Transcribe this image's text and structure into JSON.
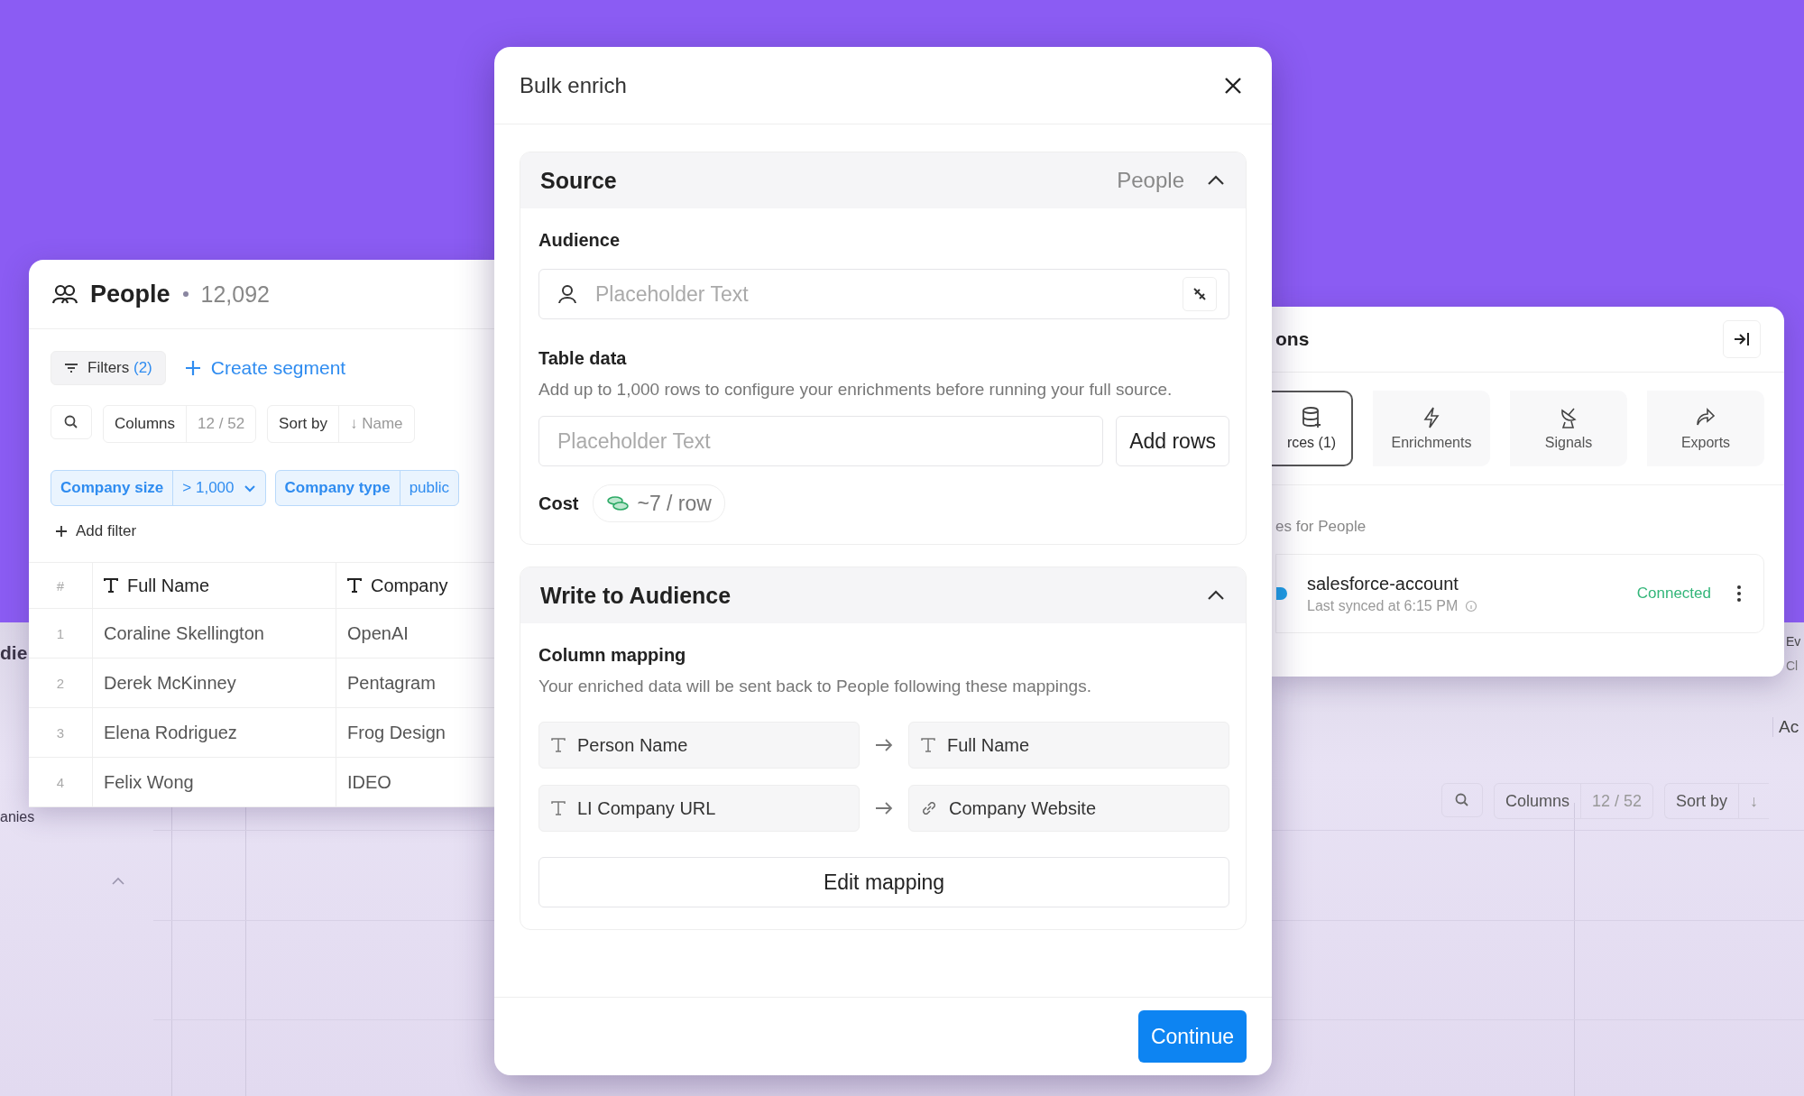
{
  "background_app": {
    "sidebar_texts": [
      "die",
      "anies"
    ],
    "right_texts": [
      "Ev",
      "Cl"
    ],
    "action_text": "Ac",
    "toolbar": {
      "columns_label": "Columns",
      "columns_count": "12 / 52",
      "sort_label": "Sort by",
      "sort_arrow": "↓"
    }
  },
  "people_panel": {
    "title": "People",
    "count": "12,092",
    "filters_label": "Filters",
    "filters_count": "(2)",
    "create_segment": "Create segment",
    "toolbar": {
      "columns_label": "Columns",
      "columns_count": "12 / 52",
      "sort_label": "Sort by",
      "sort_value": "↓ Name"
    },
    "filter_chips": [
      {
        "field": "Company size",
        "value": "> 1,000"
      },
      {
        "field": "Company type",
        "value": "public"
      }
    ],
    "add_filter": "Add filter",
    "table": {
      "columns": [
        "#",
        "Full Name",
        "Company"
      ],
      "rows": [
        {
          "index": "1",
          "name": "Coraline Skellington",
          "company": "OpenAI"
        },
        {
          "index": "2",
          "name": "Derek McKinney",
          "company": "Pentagram"
        },
        {
          "index": "3",
          "name": "Elena Rodriguez",
          "company": "Frog Design"
        },
        {
          "index": "4",
          "name": "Felix Wong",
          "company": "IDEO"
        }
      ]
    }
  },
  "integrations_panel": {
    "title": "ons",
    "tabs": [
      {
        "label": "rces (1)",
        "kind": "database",
        "selected": true
      },
      {
        "label": "Enrichments",
        "kind": "bolt",
        "selected": false
      },
      {
        "label": "Signals",
        "kind": "antenna",
        "selected": false
      },
      {
        "label": "Exports",
        "kind": "share",
        "selected": false
      }
    ],
    "section_label": "es for People",
    "source": {
      "name": "salesforce-account",
      "synced": "Last synced at 6:15 PM",
      "status": "Connected"
    }
  },
  "modal": {
    "title": "Bulk enrich",
    "source_section": {
      "title": "Source",
      "value": "People",
      "expanded": true,
      "audience_label": "Audience",
      "audience_placeholder": "Placeholder Text",
      "table_data_label": "Table data",
      "table_data_description": "Add up to 1,000 rows to configure your enrichments before running your full source.",
      "rows_placeholder": "Placeholder Text",
      "add_rows": "Add rows",
      "cost_label": "Cost",
      "cost_value": "~7 / row"
    },
    "write_section": {
      "title": "Write to Audience",
      "expanded": true,
      "mapping_label": "Column mapping",
      "mapping_description": "Your enriched data will be sent back to People following these mappings.",
      "mappings": [
        {
          "from": {
            "label": "Person Name",
            "kind": "text"
          },
          "to": {
            "label": "Full Name",
            "kind": "text"
          }
        },
        {
          "from": {
            "label": "LI Company URL",
            "kind": "text"
          },
          "to": {
            "label": "Company Website",
            "kind": "link"
          }
        }
      ],
      "edit_mapping": "Edit mapping"
    },
    "continue": "Continue"
  }
}
